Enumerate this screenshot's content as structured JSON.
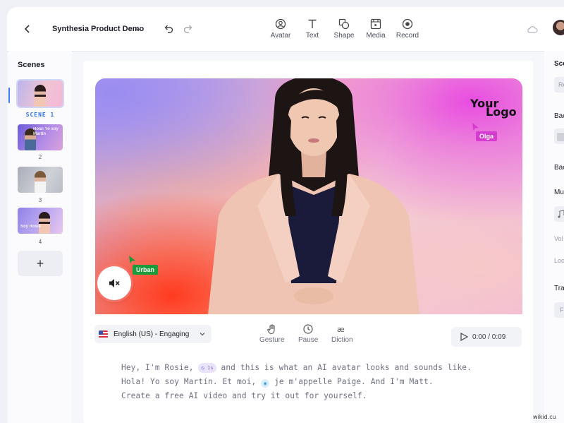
{
  "app": {
    "project_title": "Synthesia Product Demo"
  },
  "toolbar": {
    "tools": [
      {
        "label": "Avatar",
        "icon": "avatar-icon"
      },
      {
        "label": "Text",
        "icon": "text-icon"
      },
      {
        "label": "Shape",
        "icon": "shape-icon"
      },
      {
        "label": "Media",
        "icon": "media-icon"
      },
      {
        "label": "Record",
        "icon": "record-icon"
      }
    ]
  },
  "scenes": {
    "title": "Scenes",
    "items": [
      {
        "label": "SCENE 1",
        "active": true,
        "overlay": ""
      },
      {
        "label": "2",
        "active": false,
        "overlay": "Hola! Yo soy Martín"
      },
      {
        "label": "3",
        "active": false,
        "overlay": ""
      },
      {
        "label": "4",
        "active": false,
        "overlay": "Soy Rosie"
      }
    ],
    "add_label": "+"
  },
  "canvas": {
    "logo_line1": "Your",
    "logo_line2": "Logo",
    "collaborators": [
      {
        "name": "Olga",
        "color": "#d63bd0"
      },
      {
        "name": "Urban",
        "color": "#1b9c3b"
      }
    ]
  },
  "controls": {
    "language": "English (US) - Engaging",
    "actions": [
      {
        "label": "Gesture",
        "icon": "hand-icon"
      },
      {
        "label": "Pause",
        "icon": "clock-icon"
      },
      {
        "label": "Diction",
        "icon": "diction-icon"
      }
    ],
    "playback_time": "0:00 / 0:09"
  },
  "script": {
    "line1_a": "Hey, I'm Rosie,",
    "pause_chip": "1s",
    "line1_b": "and this is what an AI avatar looks and sounds like.",
    "line2_a": "Hola! Yo soy Martín. Et moi,",
    "line2_b": "je m'appelle Paige. And I'm Matt.",
    "line3": "Create a free AI video and try it out for yourself."
  },
  "right_panel": {
    "items": [
      "Sce",
      "Re",
      "Bac",
      "Bac",
      "Mu",
      "Vol",
      "Loo",
      "Tra",
      "F"
    ]
  },
  "watermark": "wikid.cu",
  "colors": {
    "accent": "#2a6de8",
    "olga_tag": "#d63bd0",
    "urban_tag": "#1b9c3b"
  }
}
